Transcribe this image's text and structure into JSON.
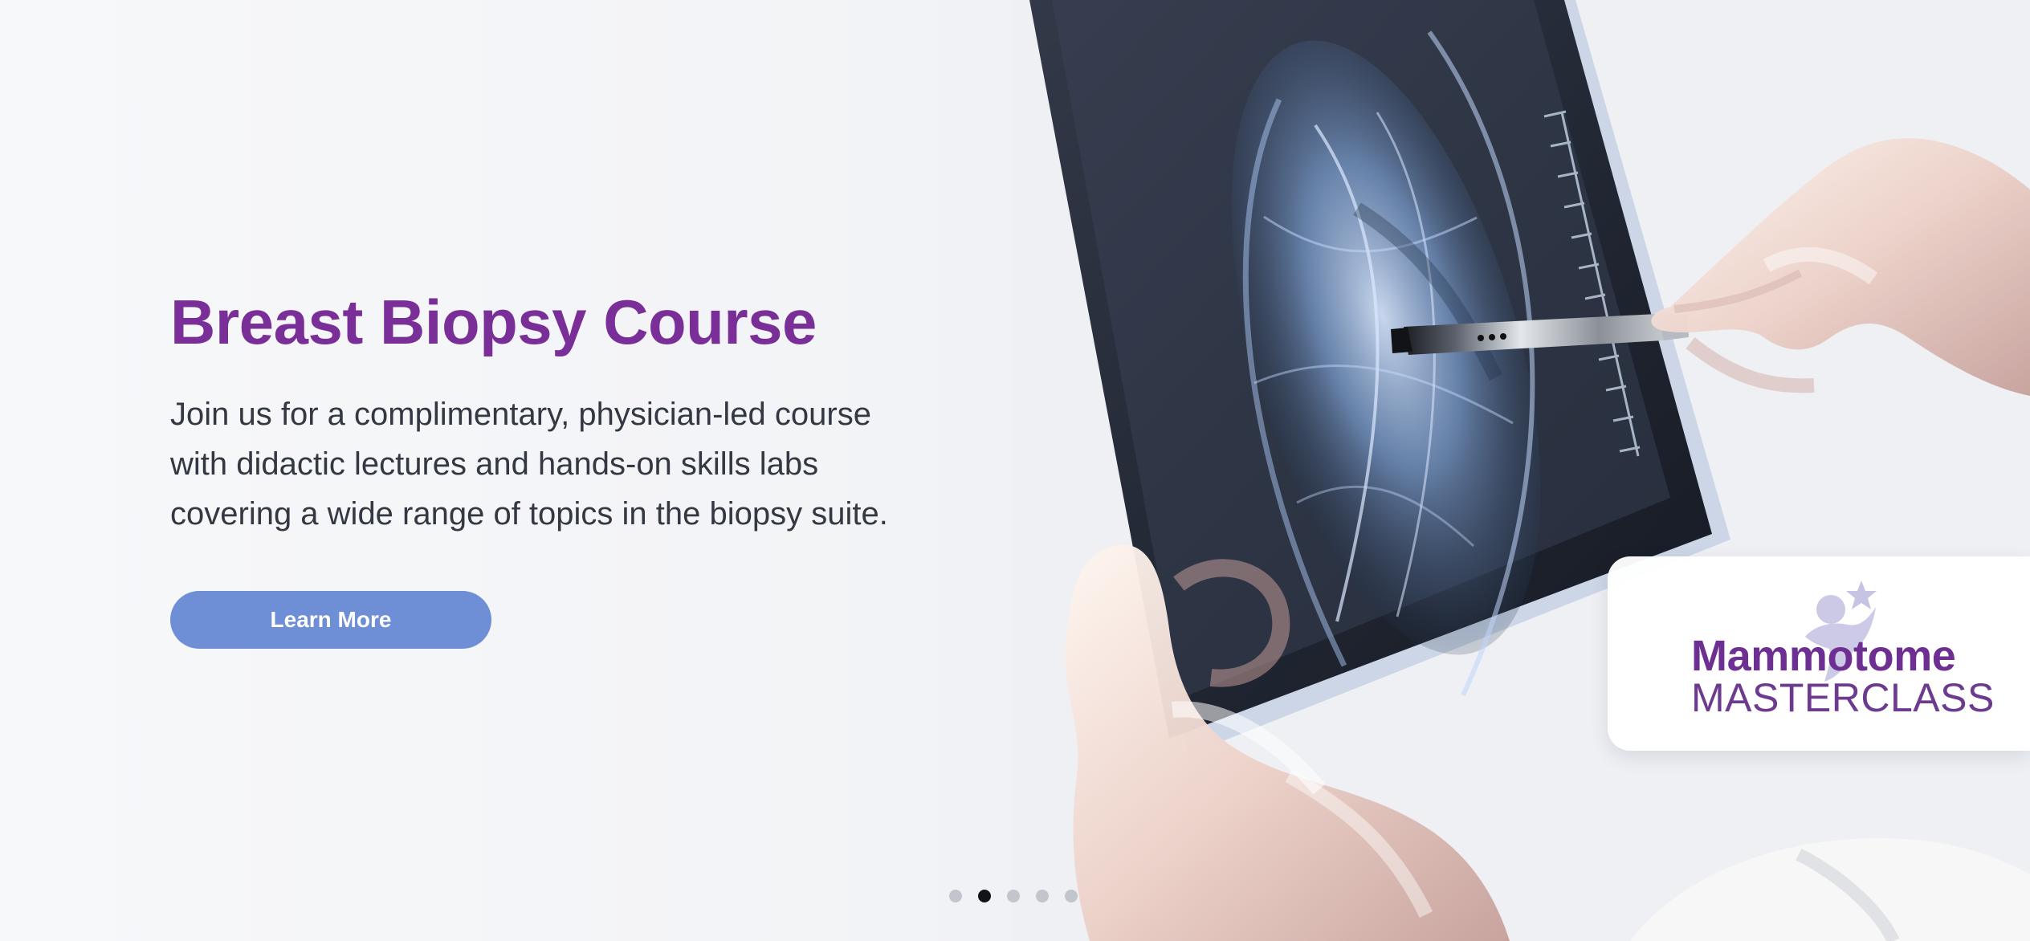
{
  "hero": {
    "title": "Breast Biopsy Course",
    "description": "Join us for a complimentary, physician-led course with didactic lectures and hands-on skills labs covering a wide range of topics in the biopsy suite.",
    "cta_label": "Learn More"
  },
  "badge": {
    "title": "Mammotome",
    "subtitle": "MASTERCLASS"
  },
  "carousel": {
    "slide_count": 5,
    "active_index": 1
  },
  "colors": {
    "headline": "#7a2f98",
    "cta": "#6e8fd5",
    "body_text": "#333842",
    "badge_text": "#6d2f91",
    "active_dot": "#111318",
    "inactive_dot": "#c2c5cb"
  },
  "icons": {
    "star": "star-icon",
    "pen": "pen-icon"
  }
}
